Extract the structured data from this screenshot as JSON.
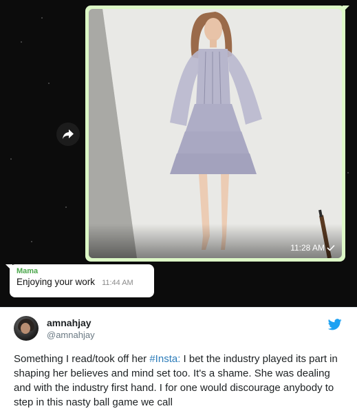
{
  "chat": {
    "image_message": {
      "time": "11:28 AM",
      "status_icon": "single-check-icon"
    },
    "text_message": {
      "sender": "Mama",
      "text": "Enjoying your work",
      "time": "11:44 AM"
    },
    "forward_icon": "forward-arrow-icon",
    "colors": {
      "background": "#0c0c0c",
      "outgoing_bubble": "#dcf8c6",
      "incoming_bubble": "#ffffff",
      "sender_name": "#4aa64a"
    }
  },
  "tweet": {
    "display_name": "amnahjay",
    "handle": "@amnahjay",
    "brand_icon": "twitter-bird-icon",
    "text_before": "Something I read/took off her ",
    "hashtag": "#Insta:",
    "text_after": " I bet the industry played its part in shaping her believes and mind set too. It's a shame. She was dealing and with the industry first hand. I for one would discourage anybody to step in this nasty ball game we call",
    "colors": {
      "link": "#2b7bb9",
      "brand": "#1da1f2",
      "text": "#1c2022",
      "secondary": "#697882"
    }
  }
}
